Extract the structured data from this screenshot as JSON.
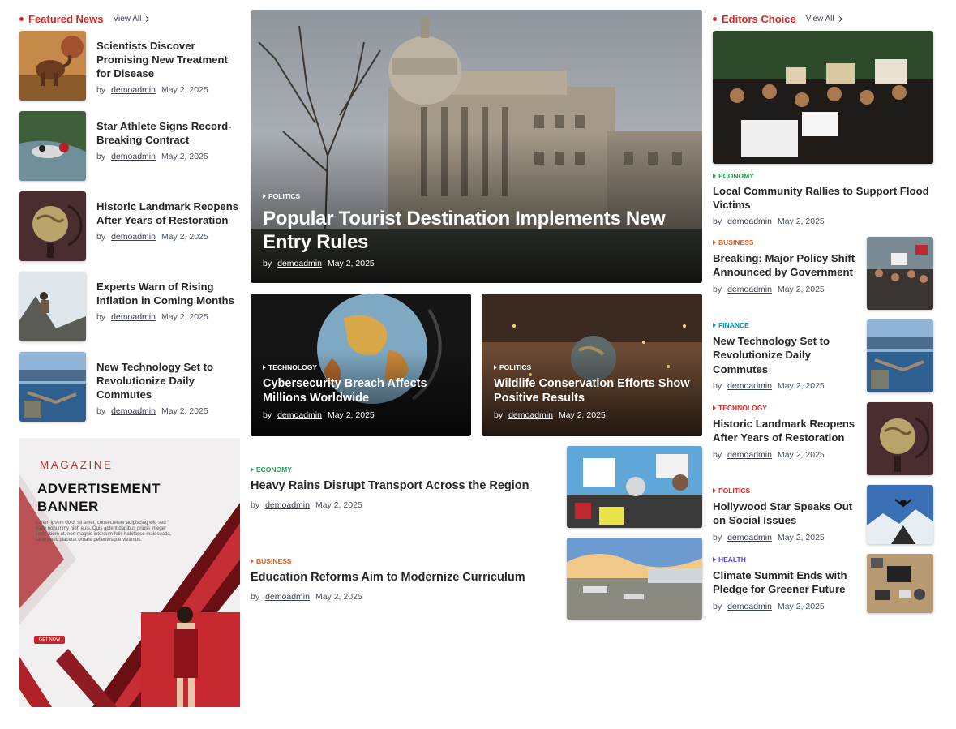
{
  "featured": {
    "title": "Featured News",
    "view_all": "View All",
    "items": [
      {
        "title": "Scientists Discover Promising New Treatment for Disease",
        "by": "by",
        "author": "demoadmin",
        "date": "May 2, 2025"
      },
      {
        "title": "Star Athlete Signs Record-Breaking Contract",
        "by": "by",
        "author": "demoadmin",
        "date": "May 2, 2025"
      },
      {
        "title": "Historic Landmark Reopens After Years of Restoration",
        "by": "by",
        "author": "demoadmin",
        "date": "May 2, 2025"
      },
      {
        "title": "Experts Warn of Rising Inflation in Coming Months",
        "by": "by",
        "author": "demoadmin",
        "date": "May 2, 2025"
      },
      {
        "title": "New Technology Set to Revolutionize Daily Commutes",
        "by": "by",
        "author": "demoadmin",
        "date": "May 2, 2025"
      }
    ]
  },
  "ad": {
    "kicker": "MAGAZINE",
    "title_line1": "ADVERTISEMENT",
    "title_line2": "BANNER",
    "body": "Lorem ipsum dolor sit amet, consectetuer adipiscing elit, sed diam nonummy nibh euis. Quis aptent dapibus primis integer justo libero ut, non magnis interdum felis habitasse malesuada, fames nec placerat ornare pellentesque vivamus.",
    "cta": "GET NOW"
  },
  "hero": {
    "category": "POLITICS",
    "title": "Popular Tourist Destination Implements New Entry Rules",
    "by": "by",
    "author": "demoadmin",
    "date": "May 2, 2025"
  },
  "cards": [
    {
      "category": "TECHNOLOGY",
      "title": "Cybersecurity Breach Affects Millions Worldwide",
      "by": "by",
      "author": "demoadmin",
      "date": "May 2, 2025"
    },
    {
      "category": "POLITICS",
      "title": "Wildlife Conservation Efforts Show Positive Results",
      "by": "by",
      "author": "demoadmin",
      "date": "May 2, 2025"
    }
  ],
  "list": [
    {
      "category": "ECONOMY",
      "title": "Heavy Rains Disrupt Transport Across the Region",
      "by": "by",
      "author": "demoadmin",
      "date": "May 2, 2025"
    },
    {
      "category": "BUSINESS",
      "title": "Education Reforms Aim to Modernize Curriculum",
      "by": "by",
      "author": "demoadmin",
      "date": "May 2, 2025"
    }
  ],
  "editors": {
    "title": "Editors Choice",
    "view_all": "View All",
    "lead": {
      "category": "ECONOMY",
      "title": "Local Community Rallies to Support Flood Victims",
      "by": "by",
      "author": "demoadmin",
      "date": "May 2, 2025"
    },
    "items": [
      {
        "category": "BUSINESS",
        "title": "Breaking: Major Policy Shift Announced by Government",
        "by": "by",
        "author": "demoadmin",
        "date": "May 2, 2025"
      },
      {
        "category": "FINANCE",
        "title": "New Technology Set to Revolutionize Daily Commutes",
        "by": "by",
        "author": "demoadmin",
        "date": "May 2, 2025"
      },
      {
        "category": "TECHNOLOGY",
        "title": "Historic Landmark Reopens After Years of Restoration",
        "by": "by",
        "author": "demoadmin",
        "date": "May 2, 2025"
      },
      {
        "category": "POLITICS",
        "title": "Hollywood Star Speaks Out on Social Issues",
        "by": "by",
        "author": "demoadmin",
        "date": "May 2, 2025"
      },
      {
        "category": "HEALTH",
        "title": "Climate Summit Ends with Pledge for Greener Future",
        "by": "by",
        "author": "demoadmin",
        "date": "May 2, 2025"
      }
    ]
  },
  "colors": {
    "accent": "#dc2626",
    "economy": "#16a34a",
    "business": "#ea580c",
    "finance": "#0891b2",
    "technology": "#dc2626",
    "politics": "#dc2626",
    "health": "#4f46e5"
  }
}
